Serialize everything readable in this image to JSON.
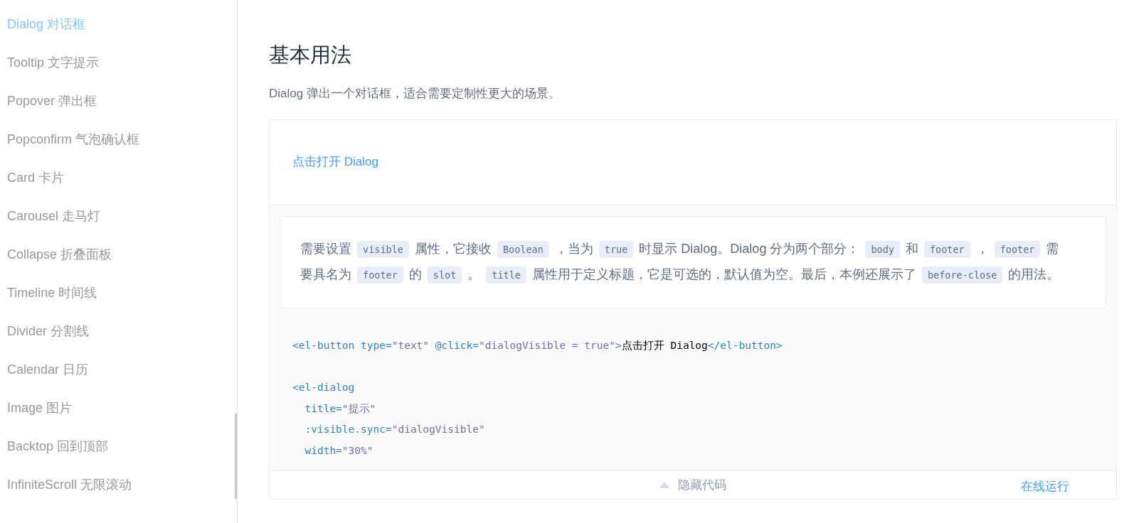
{
  "sidebar": {
    "items": [
      {
        "label": "Dialog 对话框",
        "selected": true
      },
      {
        "label": "Tooltip 文字提示",
        "selected": false
      },
      {
        "label": "Popover 弹出框",
        "selected": false
      },
      {
        "label": "Popconfirm 气泡确认框",
        "selected": false
      },
      {
        "label": "Card 卡片",
        "selected": false
      },
      {
        "label": "Carousel 走马灯",
        "selected": false
      },
      {
        "label": "Collapse 折叠面板",
        "selected": false
      },
      {
        "label": "Timeline 时间线",
        "selected": false
      },
      {
        "label": "Divider 分割线",
        "selected": false
      },
      {
        "label": "Calendar 日历",
        "selected": false
      },
      {
        "label": "Image 图片",
        "selected": false
      },
      {
        "label": "Backtop 回到顶部",
        "selected": false
      },
      {
        "label": "InfiniteScroll 无限滚动",
        "selected": false
      }
    ]
  },
  "heading": "基本用法",
  "intro": "Dialog 弹出一个对话框，适合需要定制性更大的场景。",
  "demo": {
    "link": "点击打开 Dialog",
    "description": [
      {
        "kind": "text",
        "text": "需要设置"
      },
      {
        "kind": "code",
        "text": "visible"
      },
      {
        "kind": "text",
        "text": "属性，它接收"
      },
      {
        "kind": "code",
        "text": "Boolean"
      },
      {
        "kind": "text",
        "text": "，当为"
      },
      {
        "kind": "code",
        "text": "true"
      },
      {
        "kind": "text",
        "text": "时显示 Dialog。Dialog 分为两个部分："
      },
      {
        "kind": "code",
        "text": "body"
      },
      {
        "kind": "text",
        "text": "和"
      },
      {
        "kind": "code",
        "text": "footer"
      },
      {
        "kind": "text",
        "text": "，"
      },
      {
        "kind": "code",
        "text": "footer"
      },
      {
        "kind": "text",
        "text": "需要具名为"
      },
      {
        "kind": "code",
        "text": "footer"
      },
      {
        "kind": "text",
        "text": "的"
      },
      {
        "kind": "code",
        "text": "slot"
      },
      {
        "kind": "text",
        "text": "。"
      },
      {
        "kind": "code",
        "text": "title"
      },
      {
        "kind": "text",
        "text": "属性用于定义标题，它是可选的，默认值为空。最后，本例还展示了"
      },
      {
        "kind": "code",
        "text": "before-close"
      },
      {
        "kind": "text",
        "text": "的用法。"
      }
    ],
    "code_blocks": [
      [
        [
          {
            "kind": "tag",
            "text": "<el-button "
          },
          {
            "kind": "attr",
            "text": "type="
          },
          {
            "kind": "string",
            "text": "\"text\""
          },
          {
            "kind": "attr",
            "text": " @click="
          },
          {
            "kind": "string",
            "text": "\"dialogVisible = true\""
          },
          {
            "kind": "tag",
            "text": ">"
          },
          {
            "kind": "text",
            "text": "点击打开 Dialog"
          },
          {
            "kind": "tag",
            "text": "</el-button>"
          }
        ]
      ],
      [
        [
          {
            "kind": "tag",
            "text": "<el-dialog"
          }
        ],
        [
          {
            "kind": "attr",
            "text": "  title="
          },
          {
            "kind": "string",
            "text": "\"提示\""
          }
        ],
        [
          {
            "kind": "attr",
            "text": "  :visible.sync="
          },
          {
            "kind": "string",
            "text": "\"dialogVisible\""
          }
        ],
        [
          {
            "kind": "attr",
            "text": "  width="
          },
          {
            "kind": "string",
            "text": "\"30%\""
          }
        ]
      ]
    ],
    "hide_code": "隐藏代码",
    "run_online": "在线运行"
  }
}
